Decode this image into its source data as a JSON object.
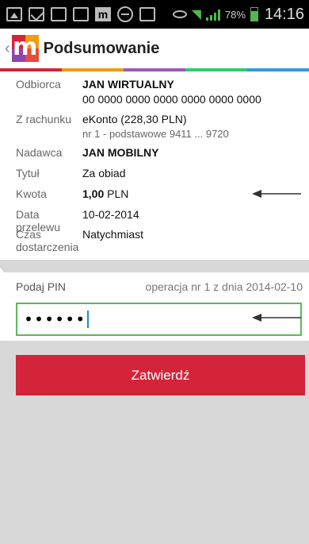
{
  "status_bar": {
    "icons": [
      "image-icon",
      "mail-icon",
      "mms-icon",
      "mms-icon",
      "mbank-icon",
      "dnd-icon",
      "briefcase-icon",
      "eye-icon",
      "wifi-icon",
      "signal-icon",
      "battery-icon"
    ],
    "battery": "78%",
    "time": "14:16"
  },
  "header": {
    "back_glyph": "‹",
    "logo_text": "m",
    "title": "Podsumowanie",
    "logo_colors": [
      "#d4243a",
      "#f39c12",
      "#8e44ad",
      "#e74c3c"
    ],
    "stripe_colors": [
      "#d4243a",
      "#f39c12",
      "#9b59b6",
      "#2ecc71",
      "#3498db"
    ]
  },
  "details": {
    "recipient_label": "Odbiorca",
    "recipient_name": "JAN WIRTUALNY",
    "recipient_account": "00 0000 0000 0000 0000 0000 0000",
    "from_label": "Z rachunku",
    "from_account": "eKonto",
    "from_balance": "(228,30 PLN)",
    "from_detail": "nr 1 - podstawowe  9411 ... 9720",
    "sender_label": "Nadawca",
    "sender_name": "JAN MOBILNY",
    "title_label": "Tytuł",
    "title_value": "Za obiad",
    "amount_label": "Kwota",
    "amount_value": "1,00",
    "amount_currency": "PLN",
    "date_label": "Data przelewu",
    "date_value": "10-02-2014",
    "delivery_label_1": "Czas",
    "delivery_label_2": "dostarczenia",
    "delivery_value": "Natychmiast"
  },
  "pin": {
    "label": "Podaj PIN",
    "operation": "operacja nr 1 z dnia 2014-02-10",
    "value": "••••••"
  },
  "confirm_button": "Zatwierdź"
}
